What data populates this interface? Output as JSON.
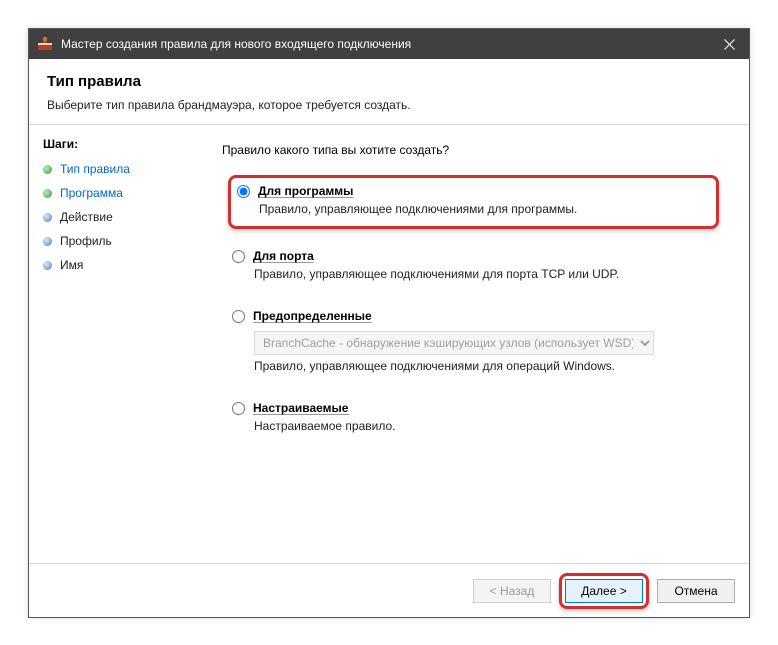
{
  "window": {
    "title": "Мастер создания правила для нового входящего подключения"
  },
  "header": {
    "title": "Тип правила",
    "subtitle": "Выберите тип правила брандмауэра, которое требуется создать."
  },
  "steps": {
    "title": "Шаги:",
    "items": [
      {
        "label": "Тип правила"
      },
      {
        "label": "Программа"
      },
      {
        "label": "Действие"
      },
      {
        "label": "Профиль"
      },
      {
        "label": "Имя"
      }
    ]
  },
  "main": {
    "prompt": "Правило какого типа вы хотите создать?",
    "options": [
      {
        "label": "Для программы",
        "desc": "Правило, управляющее подключениями для программы."
      },
      {
        "label": "Для порта",
        "desc": "Правило, управляющее подключениями для порта TCP или UDP."
      },
      {
        "label": "Предопределенные",
        "desc": "Правило, управляющее подключениями для операций Windows.",
        "dropdown": "BranchCache - обнаружение кэширующих узлов (использует WSD)"
      },
      {
        "label": "Настраиваемые",
        "desc": "Настраиваемое правило."
      }
    ]
  },
  "footer": {
    "back": "< Назад",
    "next": "Далее >",
    "cancel": "Отмена"
  }
}
